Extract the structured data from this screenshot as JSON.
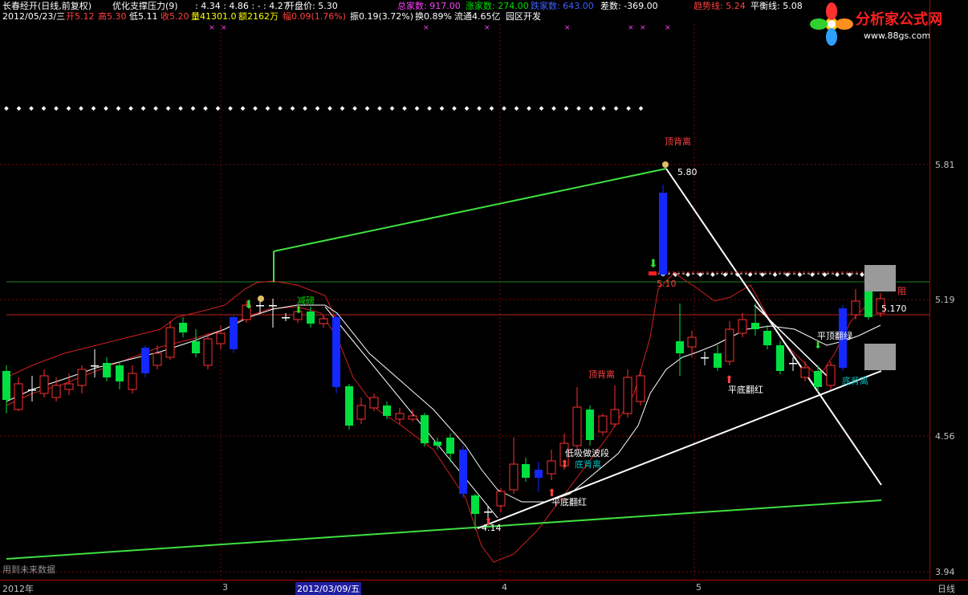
{
  "header": {
    "line1": {
      "title": "长春经开(日线,前复权)",
      "indicator": "优化支撑压力(9)",
      "values": ": 4.34 : 4.86 : - : 4.27",
      "open_label": "开盘价: 5.30",
      "total_label": "总家数: 917.00",
      "up_label": "涨家数: 274.00",
      "down_label": "跌家数: 643.00",
      "diff_label": "差数: -369.00",
      "trend_label": "趋势线: 5.24",
      "balance_label": "平衡线: 5.08"
    },
    "line2": {
      "date": "2012/05/23/三",
      "open": "开5.12",
      "high": "高5.30",
      "low": "低5.11",
      "close": "收5.20",
      "volume": "量41301.0",
      "amount": "额2162万",
      "change": "幅0.09(1.76%)",
      "amplitude": "振0.19(3.72%)",
      "turnover": "换0.89%",
      "float": "流通4.65亿",
      "sector": "园区开发"
    }
  },
  "logo": {
    "text": "分析家公式网",
    "url": "www.88gs.com"
  },
  "y_axis": {
    "ticks": [
      "5.81",
      "5.19",
      "4.56",
      "3.94"
    ]
  },
  "x_axis": {
    "labels": [
      "2012年",
      "3",
      "2012/03/09/五",
      "4",
      "5"
    ],
    "period": "日线"
  },
  "annotations": {
    "top_divergence_1": "顶背离",
    "top_divergence_2": "顶背离",
    "peak_value": "5.80",
    "mid_value": "5.10",
    "resistance": "阻",
    "right_value": "5.170",
    "reduce_position": "减磅",
    "low_absorb": "低吸做波段",
    "bottom_divergence_1": "底背离",
    "bottom_divergence_2": "底背离",
    "flat_bottom_red_1": "平底翻红",
    "flat_bottom_red_2": "平底翻红",
    "flat_top_green": "平顶翻绿",
    "low_value": "4.14",
    "future_data": "用到未来数据"
  },
  "colors": {
    "up": "#ff4040",
    "down": "#00e040",
    "blue": "#1020ff",
    "ma": "#ffffff",
    "band": "#d02020",
    "trend": "#40e040"
  }
}
